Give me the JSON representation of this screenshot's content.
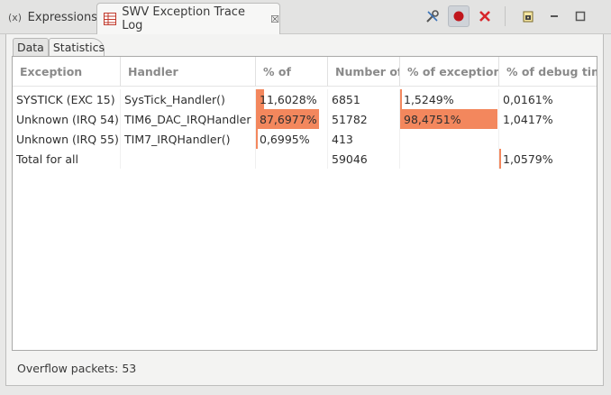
{
  "tabs": {
    "expressions_label": "Expressions",
    "swv_label": "SWV Exception Trace Log",
    "close_glyph": "☒"
  },
  "toolbar": {
    "icons": [
      "configure-icon",
      "record-icon",
      "clear-icon",
      "export-icon",
      "minimize-icon",
      "maximize-icon"
    ]
  },
  "subtabs": {
    "data": "Data",
    "statistics": "Statistics"
  },
  "table": {
    "headers": [
      "Exception",
      "Handler",
      "% of",
      "Number of",
      "% of exception t",
      "% of debug tim"
    ],
    "rows": [
      {
        "exception": "SYSTICK (EXC 15)",
        "handler": "SysTick_Handler()",
        "pct": "11,6028%",
        "number": "6851",
        "pct_exc": "1,5249%",
        "pct_debug": "0,0161%",
        "pct_fill": 0.116,
        "exc_fill": 0.015,
        "debug_fill": 0.0
      },
      {
        "exception": "Unknown (IRQ 54)",
        "handler": "TIM6_DAC_IRQHandler",
        "pct": "87,6977%",
        "number": "51782",
        "pct_exc": "98,4751%",
        "pct_debug": "1,0417%",
        "pct_fill": 0.877,
        "exc_fill": 0.985,
        "debug_fill": 0.0
      },
      {
        "exception": "Unknown (IRQ 55)",
        "handler": "TIM7_IRQHandler()",
        "pct": "0,6995%",
        "number": "413",
        "pct_exc": "",
        "pct_debug": "",
        "pct_fill": 0.007,
        "exc_fill": 0.0,
        "debug_fill": 0.0
      },
      {
        "exception": "Total for all",
        "handler": "",
        "pct": "",
        "number": "59046",
        "pct_exc": "",
        "pct_debug": "1,0579%",
        "pct_fill": 0.0,
        "exc_fill": 0.0,
        "debug_fill": 0.011
      }
    ]
  },
  "footer": {
    "overflow": "Overflow packets: 53"
  },
  "colors": {
    "bar": "#f3875d"
  }
}
